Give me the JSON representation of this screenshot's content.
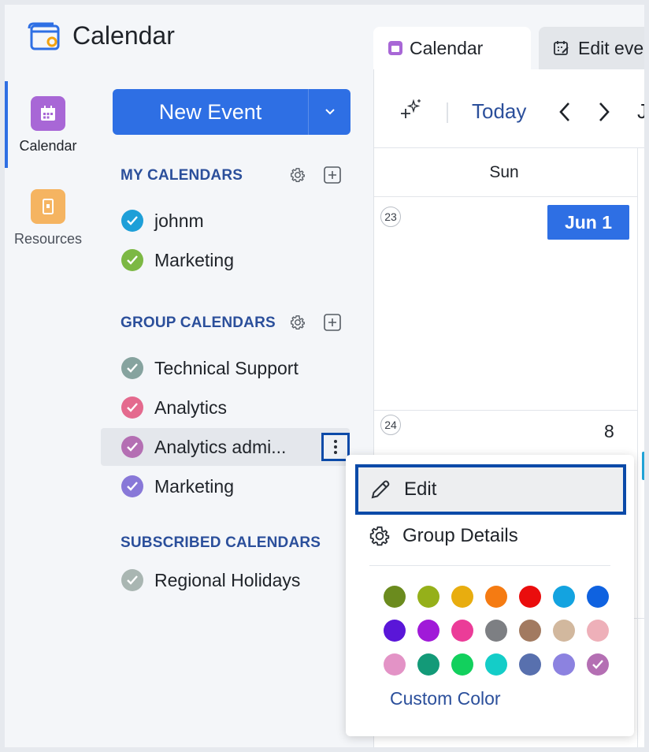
{
  "app": {
    "title": "Calendar"
  },
  "rail": [
    {
      "label": "Calendar",
      "color": "#a867d6",
      "active": true
    },
    {
      "label": "Resources",
      "color": "#f5b461",
      "active": false
    }
  ],
  "new_event": {
    "label": "New Event"
  },
  "my_calendars": {
    "heading": "MY CALENDARS",
    "items": [
      {
        "name": "johnm",
        "color": "#1e9fd8"
      },
      {
        "name": "Marketing",
        "color": "#7cb844"
      }
    ]
  },
  "group_calendars": {
    "heading": "GROUP CALENDARS",
    "items": [
      {
        "name": "Technical Support",
        "color": "#86a39f"
      },
      {
        "name": "Analytics",
        "color": "#e46a8e"
      },
      {
        "name": "Analytics admi...",
        "color": "#b46fb3",
        "selected": true
      },
      {
        "name": "Marketing",
        "color": "#8878d8"
      }
    ]
  },
  "subscribed_calendars": {
    "heading": "SUBSCRIBED CALENDARS",
    "items": [
      {
        "name": "Regional Holidays",
        "color": "#a9b6b2"
      }
    ]
  },
  "tabs": [
    {
      "label": "Calendar",
      "active": true
    },
    {
      "label": "Edit eve",
      "active": false
    }
  ],
  "toolbar": {
    "today": "Today",
    "month_partial": "J"
  },
  "grid": {
    "day_header": "Sun",
    "weeks": [
      {
        "week_number": "23",
        "date_badge": "Jun 1"
      },
      {
        "week_number": "24",
        "date": "8"
      }
    ]
  },
  "context_menu": {
    "edit": "Edit",
    "group_details": "Group Details",
    "custom_color": "Custom Color",
    "selected_color_index": 20,
    "colors": [
      "#6b8b1e",
      "#95b01a",
      "#e8ad0f",
      "#f57b12",
      "#ea0d0d",
      "#13a3e0",
      "#0f62e0",
      "#5a16d8",
      "#a01ad8",
      "#eb3c98",
      "#7d7f83",
      "#a27a60",
      "#d2b89e",
      "#eeb0b9",
      "#e393c6",
      "#139a78",
      "#12d05d",
      "#14cdc8",
      "#5870ae",
      "#8c82e0",
      "#b46fb3"
    ]
  }
}
